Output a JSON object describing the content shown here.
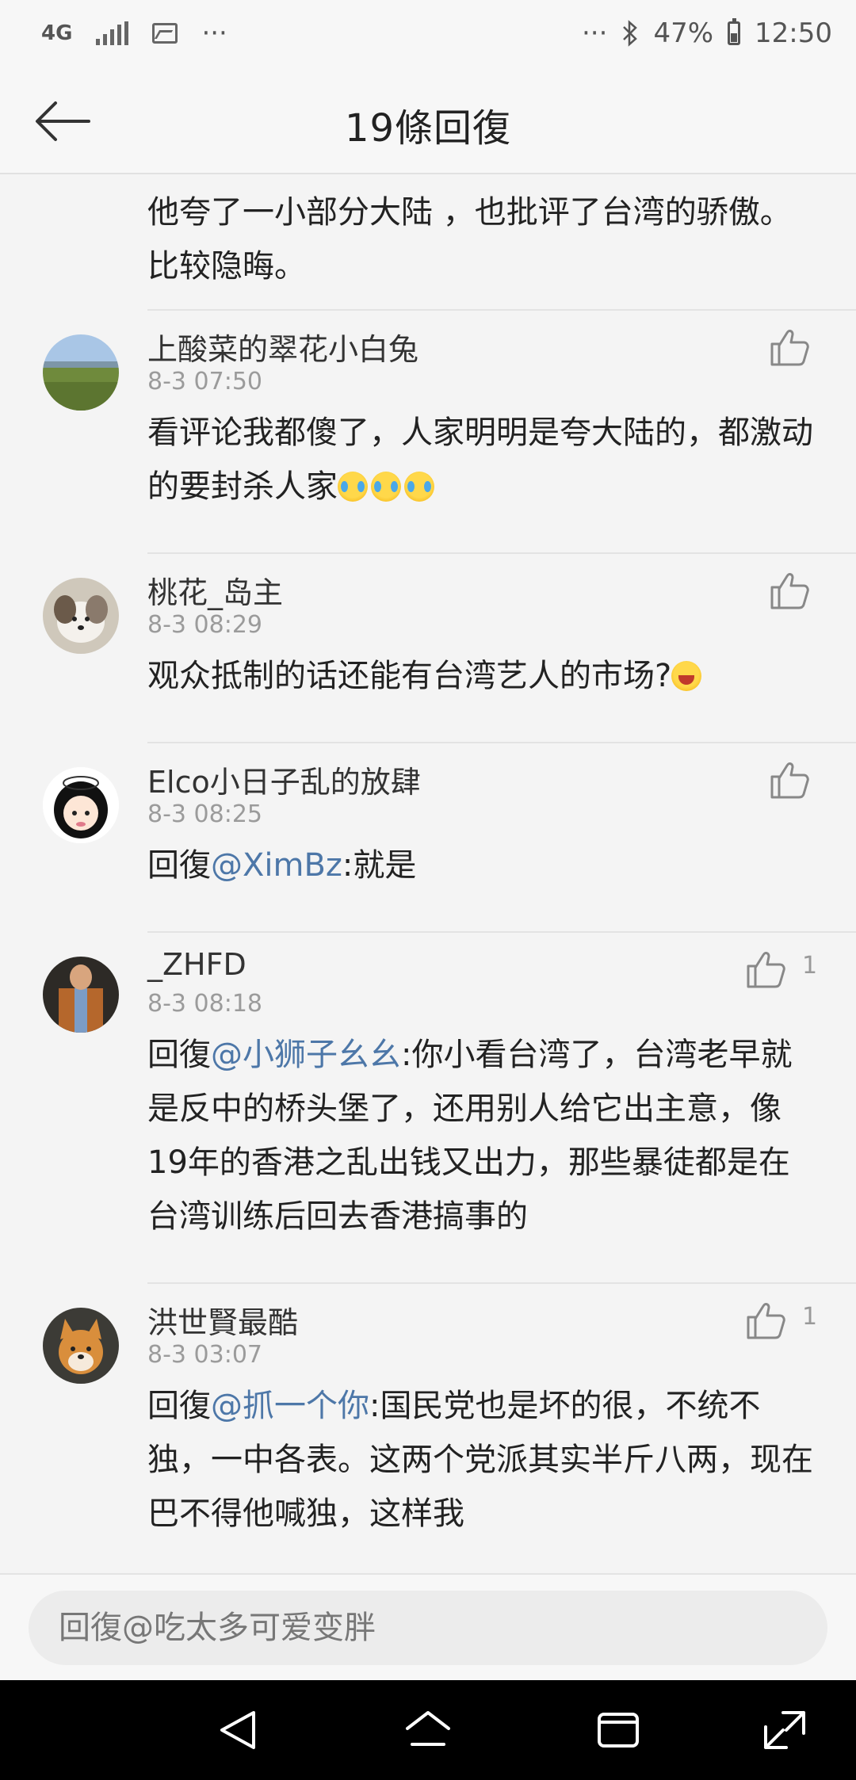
{
  "status_bar": {
    "network": "4G",
    "more_left": "···",
    "more_right": "···",
    "battery": "47%",
    "time": "12:50"
  },
  "header": {
    "title": "19條回復",
    "back_icon": "arrow-left-icon"
  },
  "comments": [
    {
      "text_parts": [
        {
          "text": "他夸了一小部分大陆 ，也批评了台湾的骄傲。比较隐晦。"
        }
      ]
    },
    {
      "username": "上酸菜的翠花小白兔",
      "time": "8-3 07:50",
      "like_count": "",
      "text_parts": [
        {
          "text": "看评论我都傻了，人家明明是夸大陆的，都激动的要封杀人家"
        }
      ],
      "emojis": [
        "cry",
        "cry",
        "cry"
      ]
    },
    {
      "username": "桃花_岛主",
      "time": "8-3 08:29",
      "like_count": "",
      "text_parts": [
        {
          "text": "观众抵制的话还能有台湾艺人的市场?"
        }
      ],
      "emojis": [
        "laugh"
      ]
    },
    {
      "username": "Elco小日子乱的放肆",
      "time": "8-3 08:25",
      "like_count": "",
      "text_parts": [
        {
          "text": "回復"
        },
        {
          "text": "@XimBz",
          "mention": true
        },
        {
          "text": ":就是"
        }
      ]
    },
    {
      "username": "_ZHFD",
      "time": "8-3 08:18",
      "like_count": "1",
      "text_parts": [
        {
          "text": "回復"
        },
        {
          "text": "@小狮子幺幺",
          "mention": true
        },
        {
          "text": ":你小看台湾了，台湾老早就是反中的桥头堡了，还用别人给它出主意，像19年的香港之乱出钱又出力，那些暴徒都是在台湾训练后回去香港搞事的"
        }
      ]
    },
    {
      "username": "洪世賢最酷",
      "time": "8-3 03:07",
      "like_count": "1",
      "text_parts": [
        {
          "text": "回復"
        },
        {
          "text": "@抓一个你",
          "mention": true
        },
        {
          "text": ":国民党也是坏的很，不统不独，一中各表。这两个党派其实半斤八两，现在巴不得他喊独，这样我"
        }
      ]
    }
  ],
  "reply_input": {
    "placeholder": "回復@吃太多可爱变胖"
  },
  "nav_bar": {
    "icons": [
      "back-triangle-icon",
      "home-icon",
      "recents-icon",
      "rotate-icon"
    ]
  },
  "colors": {
    "mention": "#4d77a8",
    "background": "#f4f4f4",
    "nav_bar": "#000000"
  }
}
